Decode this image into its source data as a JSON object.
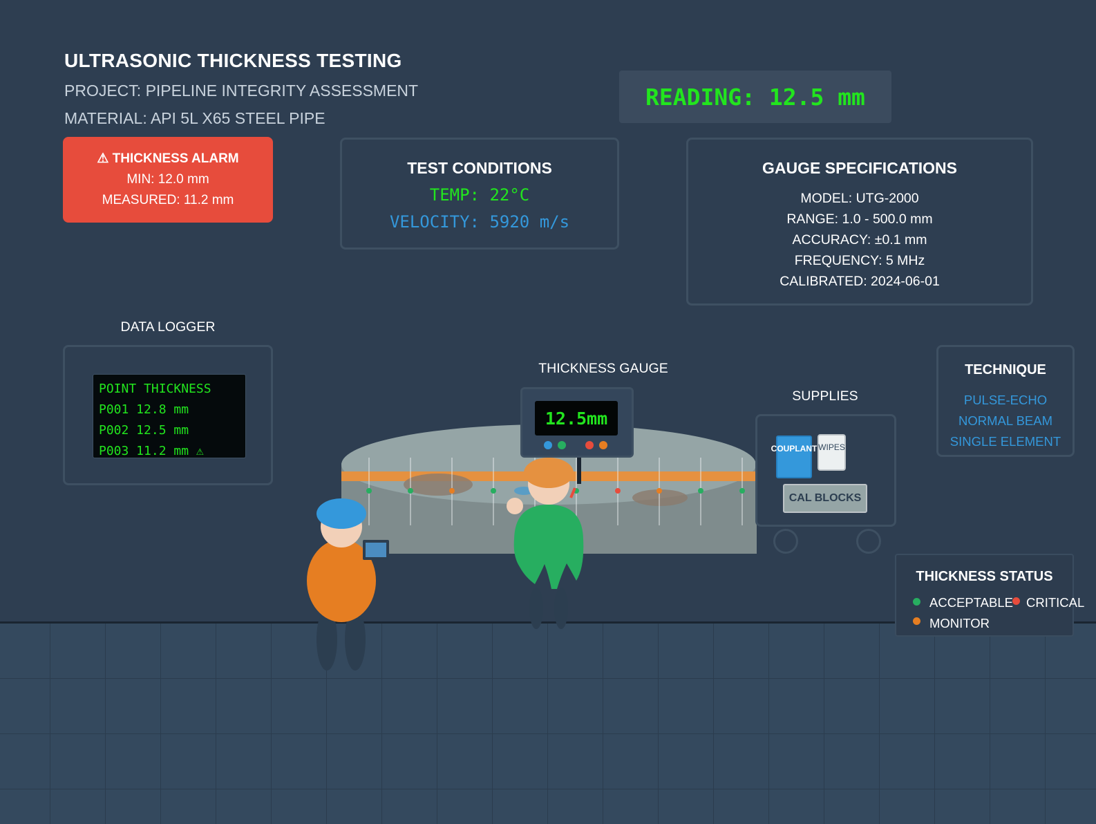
{
  "header": {
    "title": "ULTRASONIC THICKNESS TESTING",
    "project": "PROJECT: PIPELINE INTEGRITY ASSESSMENT",
    "material": "MATERIAL: API 5L X65 STEEL PIPE",
    "reading": "READING: 12.5 mm"
  },
  "alarm": {
    "title": "⚠ THICKNESS ALARM",
    "min": "MIN: 12.0 mm",
    "measured": "MEASURED: 11.2 mm"
  },
  "conditions": {
    "title": "TEST CONDITIONS",
    "temp": "TEMP: 22°C",
    "velocity": "VELOCITY: 5920 m/s"
  },
  "specs": {
    "title": "GAUGE SPECIFICATIONS",
    "model": "MODEL: UTG-2000",
    "range": "RANGE: 1.0 - 500.0 mm",
    "accuracy": "ACCURACY: ±0.1 mm",
    "frequency": "FREQUENCY: 5 MHz",
    "calibrated": "CALIBRATED: 2024-06-01"
  },
  "logger": {
    "label": "DATA LOGGER",
    "rows": [
      "POINT THICKNESS",
      "P001 12.8 mm",
      "P002 12.5 mm",
      "P003 11.2 mm ⚠"
    ]
  },
  "gauge": {
    "label": "THICKNESS GAUGE",
    "display": "12.5mm"
  },
  "supplies": {
    "label": "SUPPLIES",
    "couplant": "COUPLANT",
    "wipes": "WIPES",
    "cal_blocks": "CAL BLOCKS"
  },
  "technique": {
    "title": "TECHNIQUE",
    "items": [
      "PULSE-ECHO",
      "NORMAL BEAM",
      "SINGLE ELEMENT"
    ]
  },
  "legend": {
    "title": "THICKNESS STATUS",
    "acceptable": "ACCEPTABLE",
    "critical": "CRITICAL",
    "monitor": "MONITOR"
  },
  "colors": {
    "background": "#2e3e51",
    "acceptable": "#27ae60",
    "monitor": "#e67e22",
    "critical": "#e74c3c",
    "reading_green": "#22e51e",
    "accent_blue": "#3498db"
  }
}
